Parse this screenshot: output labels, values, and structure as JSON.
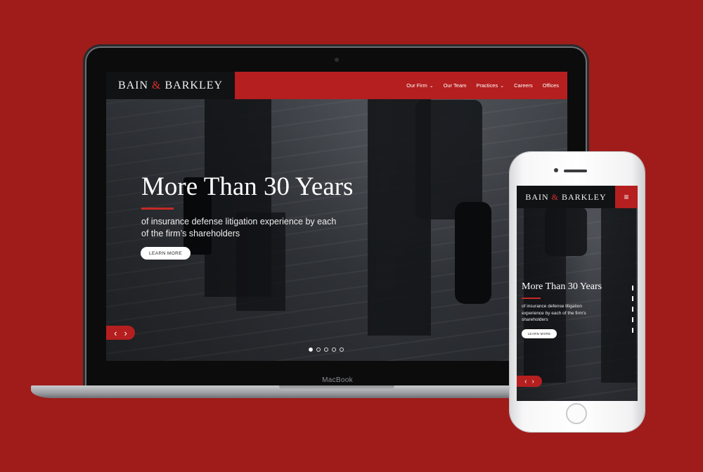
{
  "colors": {
    "background": "#a01c1a",
    "accent": "#b51f1f",
    "logo_bar": "#111214"
  },
  "brand": {
    "name_left": "BAIN",
    "amp": "&",
    "name_right": "BARKLEY"
  },
  "laptop": {
    "label": "MacBook",
    "nav": [
      {
        "label": "Our Firm",
        "has_dropdown": true
      },
      {
        "label": "Our Team",
        "has_dropdown": false
      },
      {
        "label": "Practices",
        "has_dropdown": true
      },
      {
        "label": "Careers",
        "has_dropdown": false
      },
      {
        "label": "Offices",
        "has_dropdown": false
      }
    ],
    "hero": {
      "title": "More Than 30 Years",
      "subtitle": "of insurance defense litigation experience by each of the firm’s shareholders",
      "button": "LEARN MORE"
    },
    "slider": {
      "prev": "‹",
      "next": "›",
      "slide_count": 5,
      "active_slide": 1
    }
  },
  "phone": {
    "menu_icon": "hamburger-icon",
    "hero": {
      "title": "More Than 30 Years",
      "subtitle": "of insurance defense litigation experience by each of the firm’s shareholders",
      "button": "LEARN MORE"
    },
    "slider": {
      "prev": "‹",
      "next": "›"
    }
  }
}
